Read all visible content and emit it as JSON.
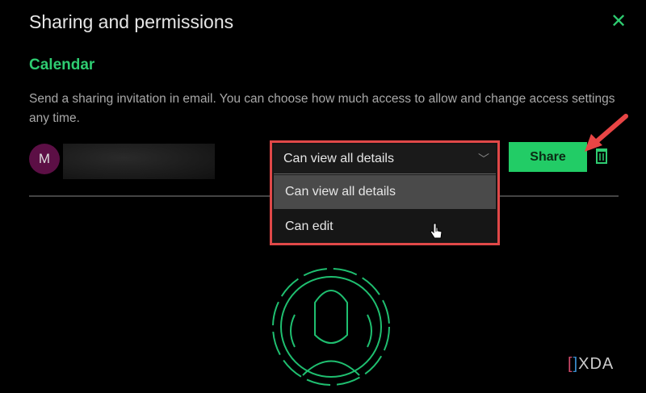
{
  "dialog": {
    "title": "Sharing and permissions",
    "close_icon": "✕",
    "calendar_name": "Calendar",
    "description": "Send a sharing invitation in email. You can choose how much access to allow and change access settings any time."
  },
  "invitee": {
    "avatar_initial": "M"
  },
  "permission": {
    "selected": "Can view all details",
    "options": [
      "Can view all details",
      "Can edit"
    ]
  },
  "buttons": {
    "share": "Share"
  },
  "watermark": {
    "text": "XDA"
  },
  "colors": {
    "accent": "#2ecc71",
    "highlight": "#e04848"
  }
}
